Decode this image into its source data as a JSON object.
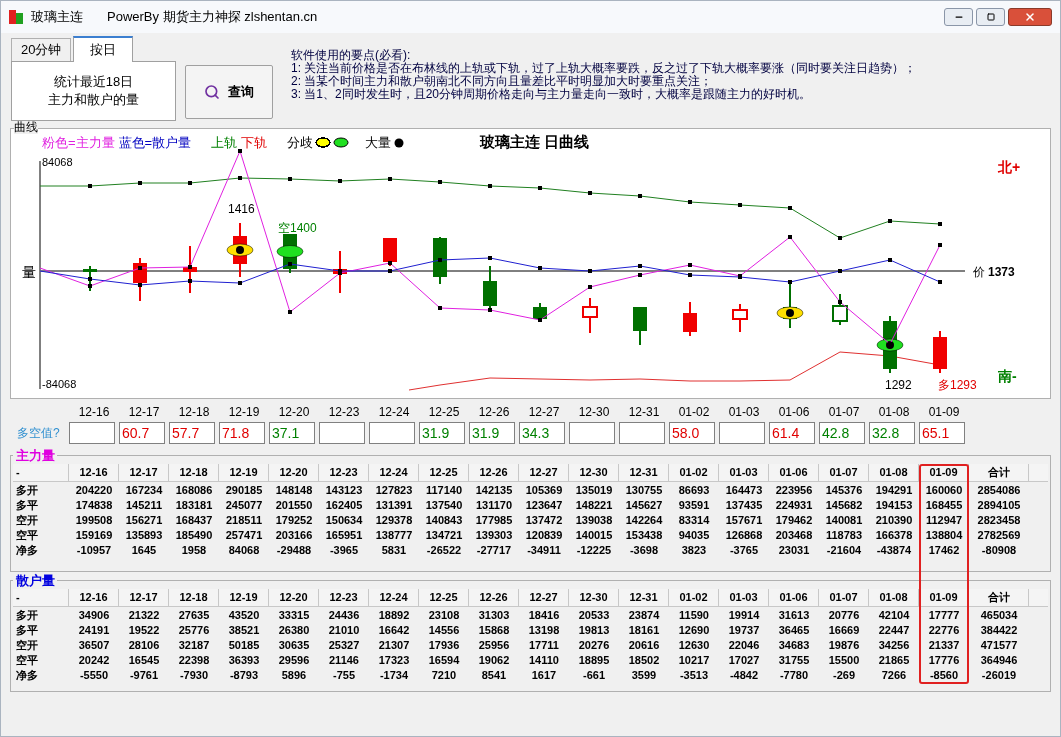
{
  "window": {
    "title": "玻璃主连",
    "subtitle": "PowerBy 期货主力神探 zlshentan.cn"
  },
  "tabs": [
    {
      "label": "20分钟",
      "selected": false
    },
    {
      "label": "按日",
      "selected": true
    }
  ],
  "panel_lines": [
    "统计最近18日",
    "主力和散户的量"
  ],
  "query_button": {
    "label": "查询"
  },
  "instructions": [
    "软件使用的要点(必看):",
    "1: 关注当前价格是否在布林线的上轨或下轨，过了上轨大概率要跌，反之过了下轨大概率要涨（同时要关注日趋势）；",
    "2: 当某个时间主力和散户朝南北不同方向且量差比平时明显加大时要重点关注；",
    "3: 当1、2同时发生时，且20分钟周期价格走向与主力量走向一致时，大概率是跟随主力的好时机。"
  ],
  "chart": {
    "group_label": "曲线",
    "title": "玻璃主连 日曲线",
    "legend": [
      {
        "label": "粉色=主力量",
        "color": "#e020e0",
        "kind": "text"
      },
      {
        "label": "蓝色=散户量",
        "color": "#0000c0",
        "kind": "text"
      },
      {
        "label": "上轨",
        "color": "#008000",
        "kind": "text"
      },
      {
        "label": "下轨",
        "color": "#e00000",
        "kind": "text"
      },
      {
        "label": "分歧",
        "color": "#000000",
        "kind": "divergence"
      },
      {
        "label": "大量",
        "color": "#000000",
        "kind": "volume"
      }
    ],
    "axis_label": "量",
    "y_max": "84068",
    "y_min": "-84068",
    "north": "北+",
    "south": "南-",
    "price_prefix": "价",
    "price": "1373",
    "annotations": [
      {
        "text": "1416",
        "color": "#000000"
      },
      {
        "text": "空1400",
        "color": "#008000"
      },
      {
        "text": "1292",
        "color": "#000000"
      },
      {
        "text": "多1293",
        "color": "#e00000"
      }
    ]
  },
  "dates": [
    "12-16",
    "12-17",
    "12-18",
    "12-19",
    "12-20",
    "12-23",
    "12-24",
    "12-25",
    "12-26",
    "12-27",
    "12-30",
    "12-31",
    "01-02",
    "01-03",
    "01-06",
    "01-07",
    "01-08",
    "01-09"
  ],
  "ratio_label": "多空值?",
  "ratios": [
    {
      "kind": "empty"
    },
    {
      "kind": "value",
      "value": "60.7",
      "color": "#e00000"
    },
    {
      "kind": "value",
      "value": "57.7",
      "color": "#e00000"
    },
    {
      "kind": "value",
      "value": "71.8",
      "color": "#e00000"
    },
    {
      "kind": "value",
      "value": "37.1",
      "color": "#008000"
    },
    {
      "kind": "empty"
    },
    {
      "kind": "empty"
    },
    {
      "kind": "value",
      "value": "31.9",
      "color": "#008000"
    },
    {
      "kind": "value",
      "value": "31.9",
      "color": "#008000"
    },
    {
      "kind": "value",
      "value": "34.3",
      "color": "#008000"
    },
    {
      "kind": "empty"
    },
    {
      "kind": "empty"
    },
    {
      "kind": "value",
      "value": "58.0",
      "color": "#e00000"
    },
    {
      "kind": "empty"
    },
    {
      "kind": "value",
      "value": "61.4",
      "color": "#e00000"
    },
    {
      "kind": "value",
      "value": "42.8",
      "color": "#008000"
    },
    {
      "kind": "value",
      "value": "32.8",
      "color": "#008000"
    },
    {
      "kind": "value",
      "value": "65.1",
      "color": "#e00000"
    }
  ],
  "tables": [
    {
      "title": "主力量",
      "color": "#e000e0",
      "columns": [
        {
          "label": "-",
          "selected": false
        },
        {
          "label": "12-16",
          "selected": false
        },
        {
          "label": "12-17",
          "selected": false
        },
        {
          "label": "12-18",
          "selected": false
        },
        {
          "label": "12-19",
          "selected": false
        },
        {
          "label": "12-20",
          "selected": false
        },
        {
          "label": "12-23",
          "selected": false
        },
        {
          "label": "12-24",
          "selected": false
        },
        {
          "label": "12-25",
          "selected": false
        },
        {
          "label": "12-26",
          "selected": false
        },
        {
          "label": "12-27",
          "selected": false
        },
        {
          "label": "12-30",
          "selected": false
        },
        {
          "label": "12-31",
          "selected": false
        },
        {
          "label": "01-02",
          "selected": false
        },
        {
          "label": "01-03",
          "selected": false
        },
        {
          "label": "01-06",
          "selected": false
        },
        {
          "label": "01-07",
          "selected": false
        },
        {
          "label": "01-08",
          "selected": false
        },
        {
          "label": "01-09",
          "selected": true
        },
        {
          "label": "合计",
          "selected": false
        }
      ],
      "rows": [
        {
          "cells": [
            "多开",
            "204220",
            "167234",
            "168086",
            "290185",
            "148148",
            "143123",
            "127823",
            "117140",
            "142135",
            "105369",
            "135019",
            "130755",
            "86693",
            "164473",
            "223956",
            "145376",
            "194291",
            "160060",
            "2854086"
          ]
        },
        {
          "cells": [
            "多平",
            "174838",
            "145211",
            "183181",
            "245077",
            "201550",
            "162405",
            "131391",
            "137540",
            "131170",
            "123647",
            "148221",
            "145627",
            "93591",
            "137435",
            "224931",
            "145682",
            "194153",
            "168455",
            "2894105"
          ]
        },
        {
          "cells": [
            "空开",
            "199508",
            "156271",
            "168437",
            "218511",
            "179252",
            "150634",
            "129378",
            "140843",
            "177985",
            "137472",
            "139038",
            "142264",
            "83314",
            "157671",
            "179462",
            "140081",
            "210390",
            "112947",
            "2823458"
          ]
        },
        {
          "cells": [
            "空平",
            "159169",
            "135893",
            "185490",
            "257471",
            "203166",
            "165951",
            "138777",
            "134721",
            "139303",
            "120839",
            "140015",
            "153438",
            "94035",
            "126868",
            "203468",
            "118783",
            "166378",
            "138804",
            "2782569"
          ]
        },
        {
          "cells": [
            "净多",
            "-10957",
            "1645",
            "1958",
            "84068",
            "-29488",
            "-3965",
            "5831",
            "-26522",
            "-27717",
            "-34911",
            "-12225",
            "-3698",
            "3823",
            "-3765",
            "23031",
            "-21604",
            "-43874",
            "17462",
            "-80908"
          ]
        }
      ]
    },
    {
      "title": "散户量",
      "color": "#0000e0",
      "columns": [
        {
          "label": "-",
          "selected": false
        },
        {
          "label": "12-16",
          "selected": false
        },
        {
          "label": "12-17",
          "selected": false
        },
        {
          "label": "12-18",
          "selected": false
        },
        {
          "label": "12-19",
          "selected": false
        },
        {
          "label": "12-20",
          "selected": false
        },
        {
          "label": "12-23",
          "selected": false
        },
        {
          "label": "12-24",
          "selected": false
        },
        {
          "label": "12-25",
          "selected": false
        },
        {
          "label": "12-26",
          "selected": false
        },
        {
          "label": "12-27",
          "selected": false
        },
        {
          "label": "12-30",
          "selected": false
        },
        {
          "label": "12-31",
          "selected": false
        },
        {
          "label": "01-02",
          "selected": false
        },
        {
          "label": "01-03",
          "selected": false
        },
        {
          "label": "01-06",
          "selected": false
        },
        {
          "label": "01-07",
          "selected": false
        },
        {
          "label": "01-08",
          "selected": false
        },
        {
          "label": "01-09",
          "selected": true
        },
        {
          "label": "合计",
          "selected": false
        }
      ],
      "rows": [
        {
          "cells": [
            "多开",
            "34906",
            "21322",
            "27635",
            "43520",
            "33315",
            "24436",
            "18892",
            "23108",
            "31303",
            "18416",
            "20533",
            "23874",
            "11590",
            "19914",
            "31613",
            "20776",
            "42104",
            "17777",
            "465034"
          ]
        },
        {
          "cells": [
            "多平",
            "24191",
            "19522",
            "25776",
            "38521",
            "26380",
            "21010",
            "16642",
            "14556",
            "15868",
            "13198",
            "19813",
            "18161",
            "12690",
            "19737",
            "36465",
            "16669",
            "22447",
            "22776",
            "384422"
          ]
        },
        {
          "cells": [
            "空开",
            "36507",
            "28106",
            "32187",
            "50185",
            "30635",
            "25327",
            "21307",
            "17936",
            "25956",
            "17711",
            "20276",
            "20616",
            "12630",
            "22046",
            "34683",
            "19876",
            "34256",
            "21337",
            "471577"
          ]
        },
        {
          "cells": [
            "空平",
            "20242",
            "16545",
            "22398",
            "36393",
            "29596",
            "21146",
            "17323",
            "16594",
            "19062",
            "14110",
            "18895",
            "18502",
            "10217",
            "17027",
            "31755",
            "15500",
            "21865",
            "17776",
            "364946"
          ]
        },
        {
          "cells": [
            "净多",
            "-5550",
            "-9761",
            "-7930",
            "-8793",
            "5896",
            "-755",
            "-1734",
            "7210",
            "8541",
            "1617",
            "-661",
            "3599",
            "-3513",
            "-4842",
            "-7780",
            "-269",
            "7266",
            "-8560",
            "-26019"
          ]
        }
      ]
    }
  ]
}
